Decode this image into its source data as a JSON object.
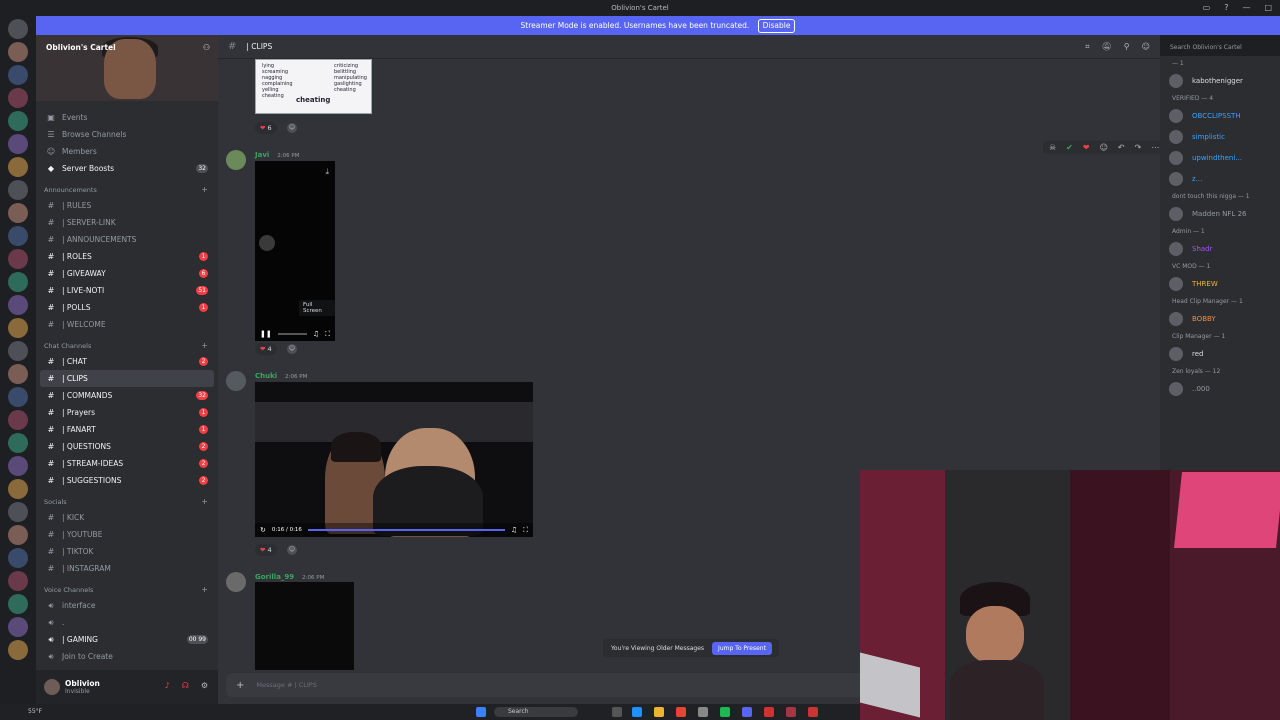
{
  "window": {
    "title": "Oblivion's Cartel"
  },
  "banner": {
    "text": "Streamer Mode is enabled. Usernames have been truncated.",
    "disable_label": "Disable"
  },
  "server": {
    "name": "Oblivion's Cartel"
  },
  "nav": {
    "top": [
      {
        "label": "Events"
      },
      {
        "label": "Browse Channels"
      },
      {
        "label": "Members"
      },
      {
        "label": "Server Boosts",
        "count": "32"
      }
    ],
    "announcements": {
      "title": "Announcements",
      "channels": [
        {
          "label": "| RULES"
        },
        {
          "label": "| SERVER-LINK"
        },
        {
          "label": "| ANNOUNCEMENTS"
        },
        {
          "label": "| ROLES",
          "count": "1"
        },
        {
          "label": "| GIVEAWAY",
          "count": "6"
        },
        {
          "label": "| LIVE-NOTI",
          "count": "51"
        },
        {
          "label": "| POLLS",
          "count": "1"
        },
        {
          "label": "| WELCOME"
        }
      ]
    },
    "chat": {
      "title": "Chat Channels",
      "channels": [
        {
          "label": "| CHAT",
          "count": "2"
        },
        {
          "label": "| CLIPS"
        },
        {
          "label": "| COMMANDS",
          "count": "32"
        },
        {
          "label": "| Prayers",
          "count": "1"
        },
        {
          "label": "| FANART",
          "count": "1"
        },
        {
          "label": "| QUESTIONS",
          "count": "2"
        },
        {
          "label": "| STREAM-IDEAS",
          "count": "2"
        },
        {
          "label": "| SUGGESTIONS",
          "count": "2"
        }
      ]
    },
    "socials": {
      "title": "Socials",
      "channels": [
        {
          "label": "| KICK"
        },
        {
          "label": "| YOUTUBE"
        },
        {
          "label": "| TIKTOK"
        },
        {
          "label": "| INSTAGRAM"
        }
      ]
    },
    "voice": {
      "title": "Voice Channels",
      "channels": [
        {
          "label": "interface"
        },
        {
          "label": "."
        },
        {
          "label": "| GAMING",
          "count": "00  99"
        },
        {
          "label": "Join to Create"
        }
      ]
    }
  },
  "user": {
    "name": "Oblivion",
    "status": "Invisible"
  },
  "channel": {
    "name": "| CLIPS",
    "search_placeholder": "Search Oblivion's Cartel"
  },
  "messages": [
    {
      "author": "Javi",
      "time": "2:06 PM",
      "reaction": "4",
      "tooltip": "Full Screen"
    },
    {
      "author": "Chuki",
      "time": "2:06 PM",
      "reaction": "4",
      "video_time": "0:16 / 0:16"
    },
    {
      "author": "Gorilla_99",
      "time": "2:06 PM"
    }
  ],
  "top_reaction": "6",
  "image_text": {
    "left": [
      "lying",
      "screaming",
      "nagging",
      "complaining",
      "yelling",
      "cheating"
    ],
    "right": [
      "criticizing",
      "belittling",
      "manipulating",
      "gaslighting",
      "cheating"
    ],
    "caption": "cheating"
  },
  "older": {
    "text": "You're Viewing Older Messages",
    "jump": "Jump To Present"
  },
  "composer": {
    "placeholder": "Message # | CLIPS"
  },
  "members": [
    {
      "group": "— 1"
    },
    {
      "name": "kabothenigger",
      "color": "#dbdee1"
    },
    {
      "group": "VERIFIED — 4"
    },
    {
      "name": "OBCCLIPSSTH",
      "color": "#3ba3ff"
    },
    {
      "name": "simplistic",
      "color": "#3ba3ff"
    },
    {
      "name": "upwindtheni...",
      "color": "#3ba3ff"
    },
    {
      "name": "z...",
      "color": "#3ba3ff"
    },
    {
      "group": "dont touch this nigga — 1"
    },
    {
      "name": "Madden NFL 26",
      "color": "#949ba4"
    },
    {
      "group": "Admin — 1"
    },
    {
      "name": "Shadr",
      "color": "#b44dff"
    },
    {
      "group": "VC MOD — 1"
    },
    {
      "name": "THREW",
      "color": "#f0b232"
    },
    {
      "group": "Head Clip Manager — 1"
    },
    {
      "name": "BOBBY",
      "color": "#f28b3a"
    },
    {
      "group": "Clip Manager — 1"
    },
    {
      "name": "red",
      "color": "#dbdee1"
    },
    {
      "group": "Zen loyals — 12"
    },
    {
      "name": "..000",
      "color": "#949ba4"
    }
  ],
  "taskbar": {
    "weather": "55°F",
    "search": "Search"
  }
}
